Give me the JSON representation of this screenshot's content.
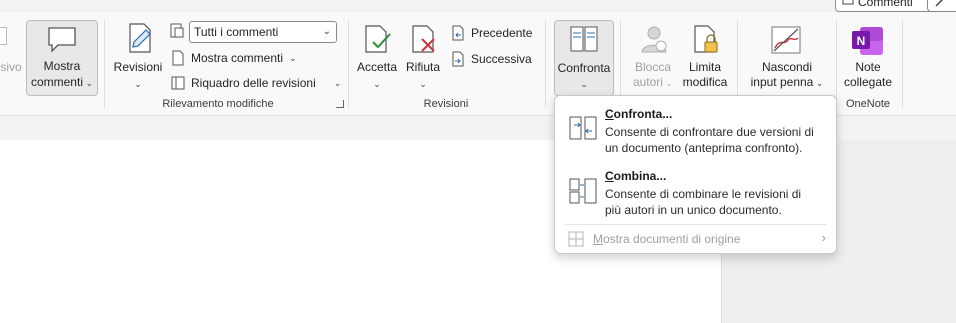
{
  "top_buttons": {
    "comments": "Commenti"
  },
  "ribbon": {
    "partial_left_label": "sivo",
    "show_comments": {
      "line1": "Mostra",
      "line2": "commenti"
    },
    "tracking": {
      "revisions_label": "Revisioni",
      "filter_dropdown": "Tutti i commenti",
      "show_markup": "Mostra commenti",
      "reviewing_pane": "Riquadro delle revisioni",
      "group_label": "Rilevamento modifiche"
    },
    "changes": {
      "accept": "Accetta",
      "reject": "Rifiuta",
      "previous": "Precedente",
      "next": "Successiva",
      "group_label": "Revisioni"
    },
    "compare": {
      "label": "Confronta"
    },
    "protect": {
      "block_authors": {
        "line1": "Blocca",
        "line2": "autori"
      },
      "restrict_editing": {
        "line1": "Limita",
        "line2": "modifica"
      }
    },
    "ink": {
      "line1": "Nascondi",
      "line2": "input penna"
    },
    "onenote": {
      "line1": "Note",
      "line2": "collegate",
      "group_label": "OneNote"
    }
  },
  "compare_menu": {
    "compare": {
      "title_key": "C",
      "title_rest": "onfronta...",
      "desc_line1": "Consente di confrontare due versioni di",
      "desc_line2": "un documento (anteprima confronto)."
    },
    "combine": {
      "title_key": "C",
      "title_rest": "ombina...",
      "desc_line1": "Consente di combinare le revisioni di",
      "desc_line2": "più autori in un unico documento."
    },
    "show_source": {
      "key": "M",
      "rest": "ostra documenti di origine"
    }
  }
}
